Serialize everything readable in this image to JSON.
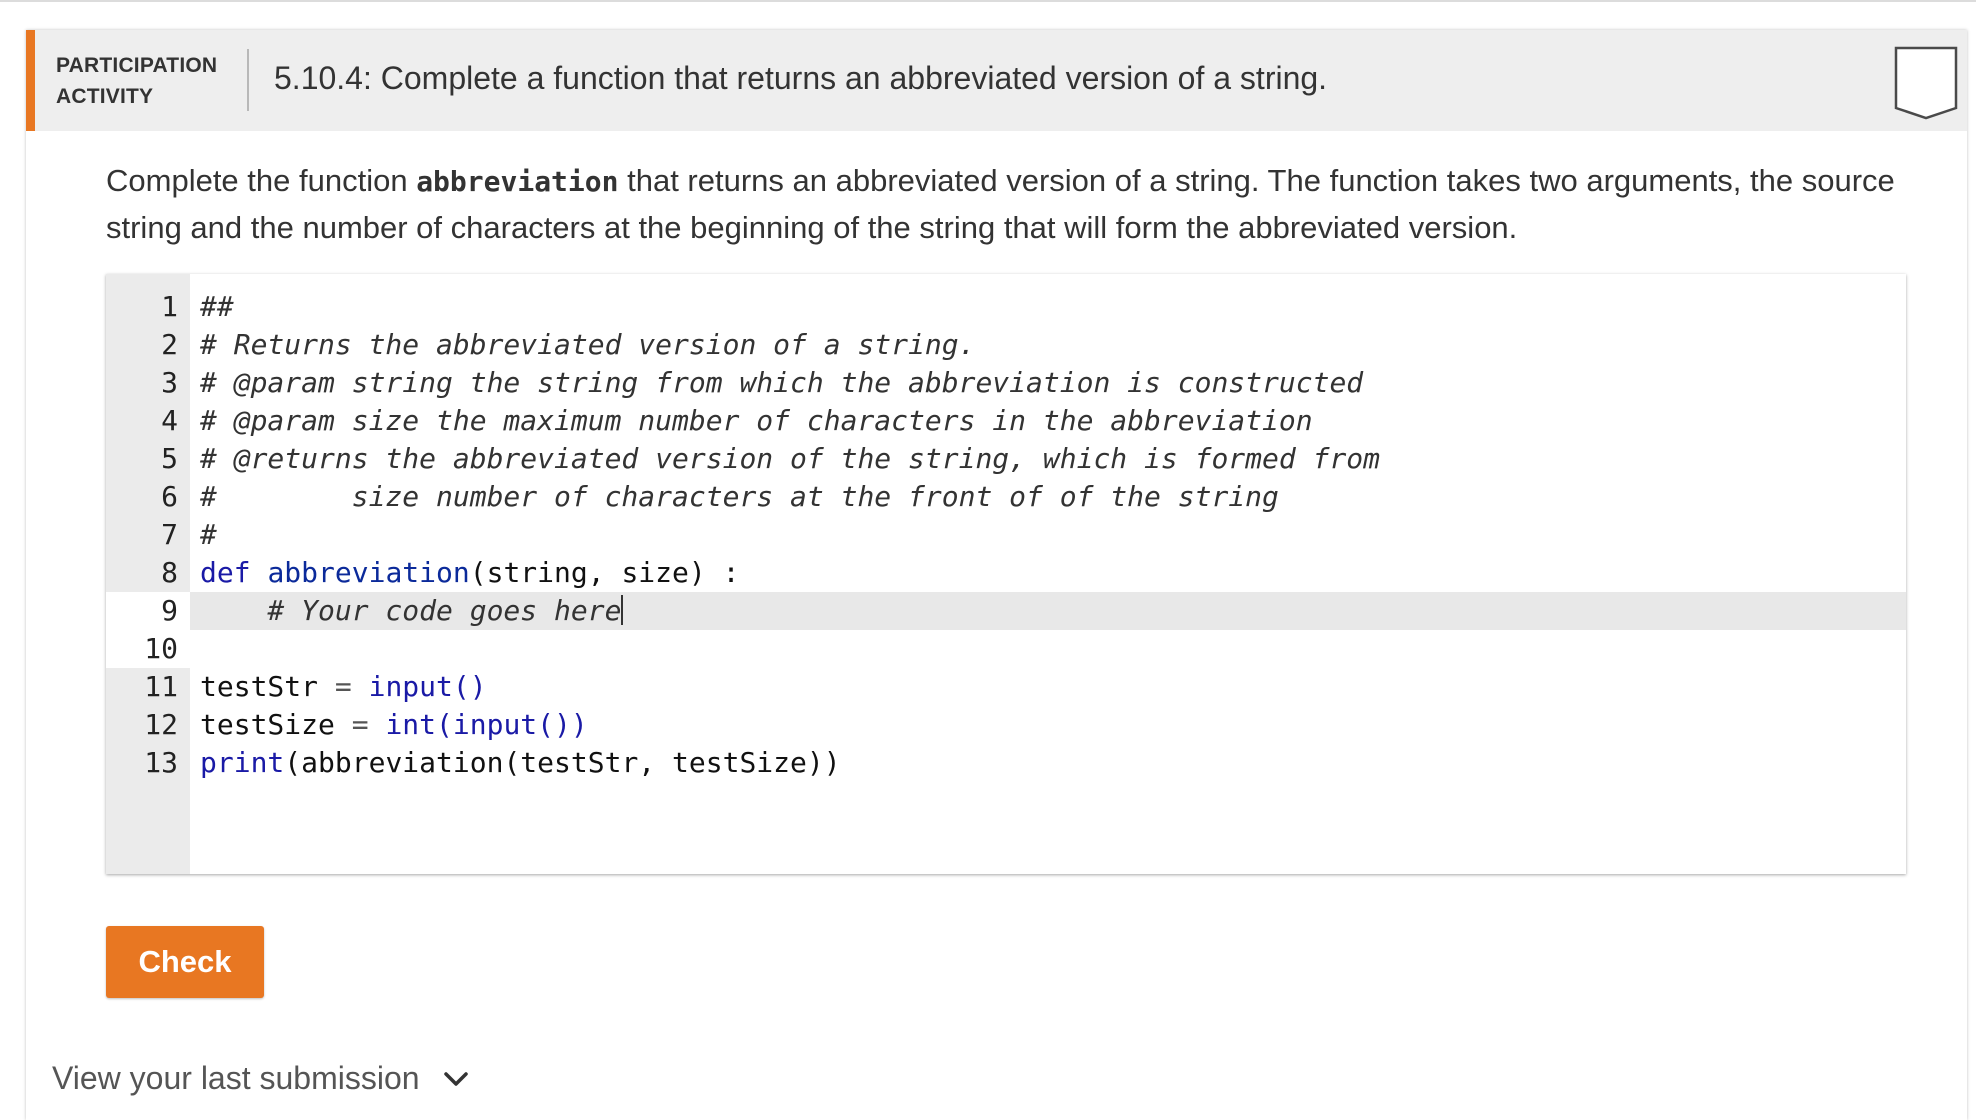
{
  "header": {
    "participation_label_line1": "PARTICIPATION",
    "participation_label_line2": "ACTIVITY",
    "activity_title": "5.10.4: Complete a function that returns an abbreviated version of a string.",
    "accent_color": "#e87722"
  },
  "instructions": {
    "before": "Complete the function ",
    "function_name": "abbreviation",
    "after": " that returns an abbreviated version of a string. The function takes two arguments, the source string and the number of characters at the beginning of the string that will form the abbreviated version."
  },
  "editor": {
    "line_numbers": [
      "1",
      "2",
      "3",
      "4",
      "5",
      "6",
      "7",
      "8",
      "9",
      "10",
      "11",
      "12",
      "13"
    ],
    "lines": {
      "l1": "##",
      "l2": "# Returns the abbreviated version of a string.",
      "l3": "# @param string the string from which the abbreviation is constructed",
      "l4": "# @param size the maximum number of characters in the abbreviation",
      "l5": "# @returns the abbreviated version of the string, which is formed from",
      "l6": "#        size number of characters at the front of of the string",
      "l7": "#",
      "l8_def": "def",
      "l8_name": "abbreviation",
      "l8_rest": "(string, size) :",
      "l9": "    # Your code goes here",
      "l10": "",
      "l11_var": "testStr",
      "l11_op": " = ",
      "l11_call": "input()",
      "l12_var": "testSize",
      "l12_op": " = ",
      "l12_call": "int(input())",
      "l13_print": "print",
      "l13_rest": "(abbreviation(testStr, testSize))"
    },
    "active_line": 9
  },
  "check_button": {
    "label": "Check",
    "color": "#e87722"
  },
  "last_submission": {
    "label": "View your last submission"
  },
  "icons": {
    "completion": "completion-badge-icon",
    "chevron": "chevron-down-icon"
  }
}
